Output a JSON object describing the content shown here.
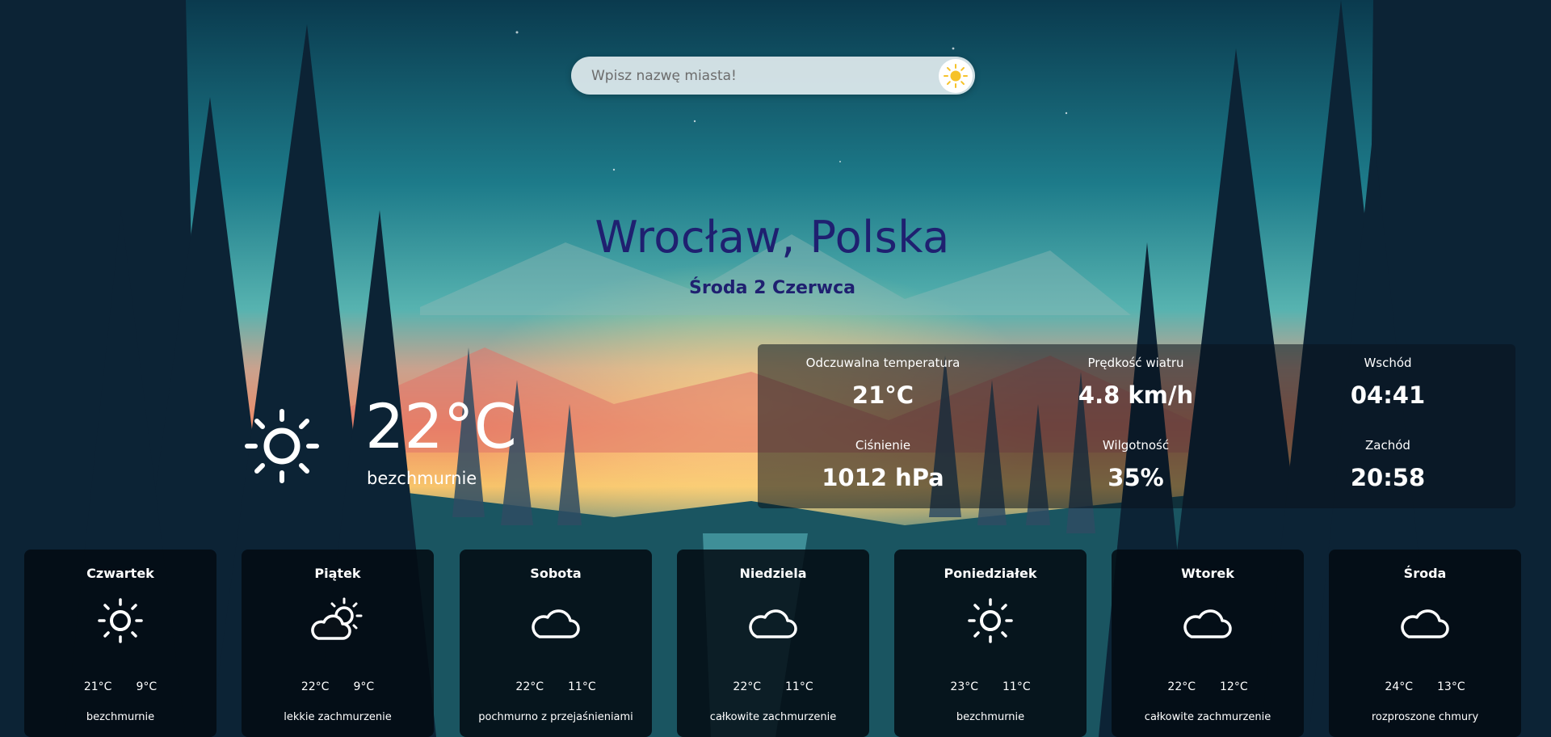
{
  "search": {
    "placeholder": "Wpisz nazwę miasta!"
  },
  "location": {
    "city": "Wrocław, Polska",
    "date": "Środa 2 Czerwca"
  },
  "current": {
    "temperature": "22°C",
    "description": "bezchmurnie",
    "icon": "sun-icon"
  },
  "details": {
    "feels_like_label": "Odczuwalna temperatura",
    "feels_like_value": "21°C",
    "wind_label": "Prędkość wiatru",
    "wind_value": "4.8 km/h",
    "sunrise_label": "Wschód",
    "sunrise_value": "04:41",
    "pressure_label": "Ciśnienie",
    "pressure_value": "1012 hPa",
    "humidity_label": "Wilgotność",
    "humidity_value": "35%",
    "sunset_label": "Zachód",
    "sunset_value": "20:58"
  },
  "forecast": [
    {
      "day": "Czwartek",
      "max": "21°C",
      "min": "9°C",
      "desc": "bezchmurnie",
      "icon": "sun-icon"
    },
    {
      "day": "Piątek",
      "max": "22°C",
      "min": "9°C",
      "desc": "lekkie zachmurzenie",
      "icon": "partly-cloudy-icon"
    },
    {
      "day": "Sobota",
      "max": "22°C",
      "min": "11°C",
      "desc": "pochmurno z przejaśnieniami",
      "icon": "cloud-icon"
    },
    {
      "day": "Niedziela",
      "max": "22°C",
      "min": "11°C",
      "desc": "całkowite zachmurzenie",
      "icon": "cloud-icon"
    },
    {
      "day": "Poniedziałek",
      "max": "23°C",
      "min": "11°C",
      "desc": "bezchmurnie",
      "icon": "sun-icon"
    },
    {
      "day": "Wtorek",
      "max": "22°C",
      "min": "12°C",
      "desc": "całkowite zachmurzenie",
      "icon": "cloud-icon"
    },
    {
      "day": "Środa",
      "max": "24°C",
      "min": "13°C",
      "desc": "rozproszone chmury",
      "icon": "cloud-icon"
    }
  ],
  "colors": {
    "title": "#1f2070",
    "panel": "#0a121c",
    "search_bg": "#ebf2f5"
  }
}
